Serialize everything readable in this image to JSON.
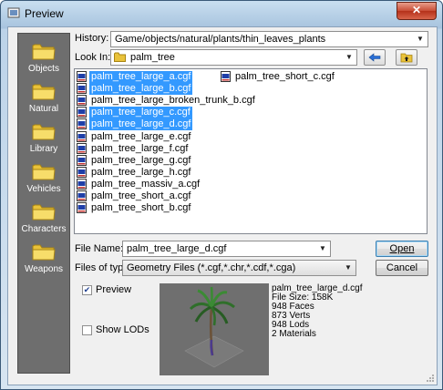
{
  "window": {
    "title": "Preview",
    "close_glyph": "✕"
  },
  "places": [
    {
      "label": "Objects",
      "icon": "folder-icon"
    },
    {
      "label": "Natural",
      "icon": "folder-icon"
    },
    {
      "label": "Library",
      "icon": "folder-icon"
    },
    {
      "label": "Vehicles",
      "icon": "folder-icon"
    },
    {
      "label": "Characters",
      "icon": "folder-icon"
    },
    {
      "label": "Weapons",
      "icon": "folder-icon"
    }
  ],
  "history": {
    "label": "History:",
    "value": "Game/objects/natural/plants/thin_leaves_plants"
  },
  "look_in": {
    "label": "Look In:",
    "value": "palm_tree"
  },
  "files": [
    {
      "name": "palm_tree_large_a.cgf",
      "selected": true
    },
    {
      "name": "palm_tree_large_b.cgf",
      "selected": true
    },
    {
      "name": "palm_tree_large_broken_trunk_b.cgf",
      "selected": false
    },
    {
      "name": "palm_tree_large_c.cgf",
      "selected": true
    },
    {
      "name": "palm_tree_large_d.cgf",
      "selected": true
    },
    {
      "name": "palm_tree_large_e.cgf",
      "selected": false
    },
    {
      "name": "palm_tree_large_f.cgf",
      "selected": false
    },
    {
      "name": "palm_tree_large_g.cgf",
      "selected": false
    },
    {
      "name": "palm_tree_large_h.cgf",
      "selected": false
    },
    {
      "name": "palm_tree_massiv_a.cgf",
      "selected": false
    },
    {
      "name": "palm_tree_short_a.cgf",
      "selected": false
    },
    {
      "name": "palm_tree_short_b.cgf",
      "selected": false
    },
    {
      "name": "palm_tree_short_c.cgf",
      "selected": false
    }
  ],
  "file_name": {
    "label": "File Name:",
    "value": "palm_tree_large_d.cgf"
  },
  "files_of_type": {
    "label": "Files of type:",
    "value": "Geometry Files (*.cgf,*.chr,*.cdf,*.cga)"
  },
  "buttons": {
    "open": "Open",
    "cancel": "Cancel"
  },
  "preview_checkbox": {
    "label": "Preview",
    "checked": true
  },
  "show_lods_checkbox": {
    "label": "Show LODs",
    "checked": false
  },
  "info": {
    "name": "palm_tree_large_d.cgf",
    "size": "File Size: 158K",
    "faces": "948 Faces",
    "verts": "873 Verts",
    "lods": "948 Lods",
    "materials": "2 Materials"
  },
  "colors": {
    "selection": "#3399ff",
    "places_bar": "#6e6e6e",
    "preview_bg": "#6f6f6f"
  }
}
